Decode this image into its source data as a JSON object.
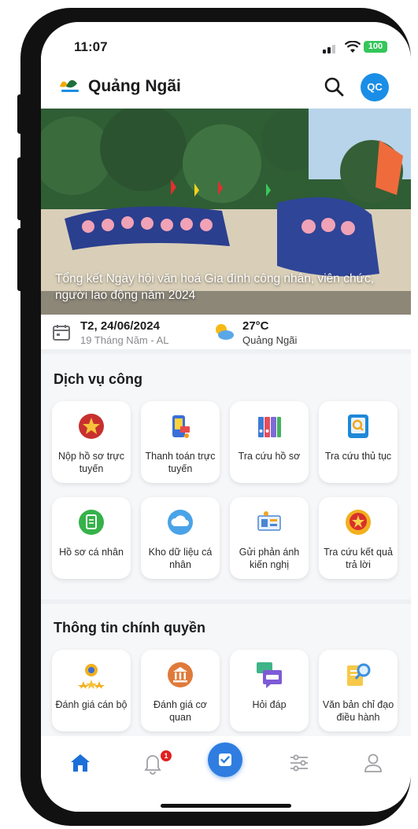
{
  "status_bar": {
    "time": "11:07",
    "battery": "100"
  },
  "app_bar": {
    "title": "Quảng Ngãi",
    "avatar_initials": "QC",
    "accent": "#1a8ee6"
  },
  "hero": {
    "caption": "Tổng kết Ngày hội văn hoá Gia đình công nhân, viên chức, người lao động năm 2024"
  },
  "date_bar": {
    "date": "T2, 24/06/2024",
    "lunar": "19 Tháng Năm - AL",
    "temperature": "27°C",
    "location": "Quảng Ngãi"
  },
  "public_services": {
    "title": "Dịch vụ công",
    "items": [
      {
        "label": "Nộp hồ sơ trực tuyến",
        "icon": "star-emblem-icon"
      },
      {
        "label": "Thanh toán trực tuyến",
        "icon": "payment-phone-icon"
      },
      {
        "label": "Tra cứu hồ sơ",
        "icon": "binders-icon"
      },
      {
        "label": "Tra cứu thủ tục",
        "icon": "document-search-icon"
      },
      {
        "label": "Hồ sơ cá nhân",
        "icon": "clipboard-icon"
      },
      {
        "label": "Kho dữ liệu cá nhân",
        "icon": "cloud-icon"
      },
      {
        "label": "Gửi phản ánh kiến nghị",
        "icon": "feedback-icon"
      },
      {
        "label": "Tra cứu kết quả trả lời",
        "icon": "national-emblem-icon"
      }
    ]
  },
  "government_info": {
    "title": "Thông tin chính quyền",
    "items": [
      {
        "label": "Đánh giá cán bộ",
        "icon": "award-icon"
      },
      {
        "label": "Đánh giá cơ quan",
        "icon": "institution-icon"
      },
      {
        "label": "Hỏi đáp",
        "icon": "faq-icon"
      },
      {
        "label": "Văn bản chỉ đạo điều hành",
        "icon": "document-magnifier-icon"
      }
    ]
  },
  "bottom_nav": {
    "items": [
      "home-icon",
      "bell-icon",
      "check-icon",
      "sliders-icon",
      "user-icon"
    ],
    "notification_count": "1"
  }
}
